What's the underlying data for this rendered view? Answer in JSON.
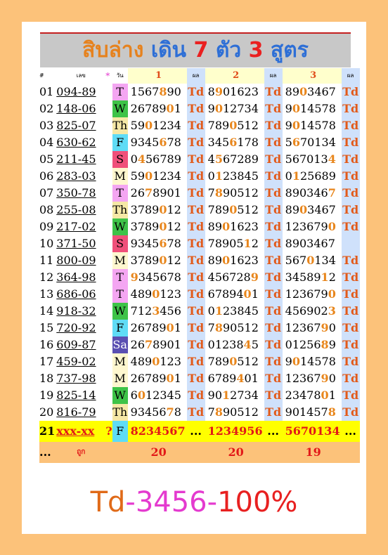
{
  "title": {
    "part1": "สิบล่าง",
    "part2": " เดิน ",
    "part3": "7",
    "part4": " ตัว ",
    "part5": "3",
    "part6": " สูตร"
  },
  "header": {
    "no": "#",
    "code": "เลข",
    "star": "*",
    "day": "วัน",
    "f1": "1",
    "f2": "2",
    "f3": "3",
    "pl": "ผล"
  },
  "rows": [
    {
      "no": "01",
      "code": "094-89",
      "day": "T",
      "dayClass": "T",
      "f": [
        [
          "1567",
          "8",
          "90"
        ],
        [
          "8",
          "9",
          "01623"
        ],
        [
          "89",
          "0",
          "3467"
        ]
      ],
      "r": [
        "Td",
        "Td",
        "Td"
      ]
    },
    {
      "no": "02",
      "code": "148-06",
      "day": "W",
      "dayClass": "W",
      "f": [
        [
          "26789",
          "0",
          "1"
        ],
        [
          "9",
          "0",
          "12734"
        ],
        [
          "9",
          "0",
          "14578"
        ]
      ],
      "r": [
        "Td",
        "Td",
        "Td"
      ]
    },
    {
      "no": "03",
      "code": "825-07",
      "day": "Th",
      "dayClass": "Th",
      "f": [
        [
          "59",
          "0",
          "1234"
        ],
        [
          "789",
          "0",
          "512"
        ],
        [
          "9",
          "0",
          "14578"
        ]
      ],
      "r": [
        "Td",
        "Td",
        "Td"
      ]
    },
    {
      "no": "04",
      "code": "630-62",
      "day": "F",
      "dayClass": "F",
      "f": [
        [
          "9345",
          "6",
          "78"
        ],
        [
          "345",
          "6",
          "178"
        ],
        [
          "5",
          "6",
          "70134"
        ]
      ],
      "r": [
        "Td",
        "Td",
        "Td"
      ]
    },
    {
      "no": "05",
      "code": "211-45",
      "day": "S",
      "dayClass": "S",
      "f": [
        [
          "0",
          "4",
          "56789"
        ],
        [
          "4",
          "5",
          "67289"
        ],
        [
          "567013",
          "4",
          ""
        ]
      ],
      "r": [
        "Td",
        "Td",
        "Td"
      ]
    },
    {
      "no": "06",
      "code": "283-03",
      "day": "M",
      "dayClass": "M",
      "f": [
        [
          "59",
          "0",
          "1234"
        ],
        [
          "0",
          "1",
          "23845"
        ],
        [
          "0",
          "1",
          "25689"
        ]
      ],
      "r": [
        "Td",
        "Td",
        "Td"
      ]
    },
    {
      "no": "07",
      "code": "350-78",
      "day": "T",
      "dayClass": "T",
      "f": [
        [
          "26",
          "7",
          "8901"
        ],
        [
          "7",
          "8",
          "90512"
        ],
        [
          "890346",
          "7",
          ""
        ]
      ],
      "r": [
        "Td",
        "Td",
        "Td"
      ]
    },
    {
      "no": "08",
      "code": "255-08",
      "day": "Th",
      "dayClass": "Th",
      "f": [
        [
          "3789",
          "0",
          "12"
        ],
        [
          "789",
          "0",
          "512"
        ],
        [
          "89",
          "0",
          "3467"
        ]
      ],
      "r": [
        "Td",
        "Td",
        "Td"
      ]
    },
    {
      "no": "09",
      "code": "217-02",
      "day": "W",
      "dayClass": "W",
      "f": [
        [
          "3789",
          "0",
          "12"
        ],
        [
          "89",
          "0",
          "1623"
        ],
        [
          "123679",
          "0",
          ""
        ]
      ],
      "r": [
        "Td",
        "Td",
        "Td"
      ]
    },
    {
      "no": "10",
      "code": "371-50",
      "day": "S",
      "dayClass": "S",
      "f": [
        [
          "9345",
          "6",
          "78"
        ],
        [
          "78905",
          "1",
          "2"
        ],
        [
          "8903467",
          "",
          ""
        ]
      ],
      "r": [
        "Td",
        "Td",
        ""
      ]
    },
    {
      "no": "11",
      "code": "800-09",
      "day": "M",
      "dayClass": "M",
      "f": [
        [
          "3789",
          "0",
          "12"
        ],
        [
          "89",
          "0",
          "1623"
        ],
        [
          "567",
          "0",
          "134"
        ]
      ],
      "r": [
        "Td",
        "Td",
        "Td"
      ]
    },
    {
      "no": "12",
      "code": "364-98",
      "day": "T",
      "dayClass": "T",
      "f": [
        [
          "",
          "9",
          "345678"
        ],
        [
          "456728",
          "9",
          ""
        ],
        [
          "34589",
          "1",
          "2"
        ]
      ],
      "r": [
        "Td",
        "Td",
        "Td"
      ]
    },
    {
      "no": "13",
      "code": "686-06",
      "day": "T",
      "dayClass": "T",
      "f": [
        [
          "489",
          "0",
          "123"
        ],
        [
          "67894",
          "0",
          "1"
        ],
        [
          "123679",
          "0",
          ""
        ]
      ],
      "r": [
        "Td",
        "Td",
        "Td"
      ]
    },
    {
      "no": "14",
      "code": "918-32",
      "day": "W",
      "dayClass": "W",
      "f": [
        [
          "712",
          "3",
          "456"
        ],
        [
          "0",
          "1",
          "23845"
        ],
        [
          "456902",
          "3",
          ""
        ]
      ],
      "r": [
        "Td",
        "Td",
        "Td"
      ]
    },
    {
      "no": "15",
      "code": "720-92",
      "day": "F",
      "dayClass": "F",
      "f": [
        [
          "26789",
          "0",
          "1"
        ],
        [
          "7",
          "8",
          "90512"
        ],
        [
          "12367",
          "9",
          "0"
        ]
      ],
      "r": [
        "Td",
        "Td",
        "Td"
      ]
    },
    {
      "no": "16",
      "code": "609-87",
      "day": "Sa",
      "dayClass": "Sa",
      "f": [
        [
          "26",
          "7",
          "8901"
        ],
        [
          "01238",
          "4",
          "5"
        ],
        [
          "01256",
          "8",
          "9"
        ]
      ],
      "r": [
        "Td",
        "Td",
        "Td"
      ]
    },
    {
      "no": "17",
      "code": "459-02",
      "day": "M",
      "dayClass": "M",
      "f": [
        [
          "489",
          "0",
          "123"
        ],
        [
          "789",
          "0",
          "512"
        ],
        [
          "9",
          "0",
          "14578"
        ]
      ],
      "r": [
        "Td",
        "Td",
        "Td"
      ]
    },
    {
      "no": "18",
      "code": "737-98",
      "day": "M",
      "dayClass": "M",
      "f": [
        [
          "26789",
          "0",
          "1"
        ],
        [
          "6789",
          "4",
          "01"
        ],
        [
          "12367",
          "9",
          "0"
        ]
      ],
      "r": [
        "Td",
        "Td",
        "Td"
      ]
    },
    {
      "no": "19",
      "code": "825-14",
      "day": "W",
      "dayClass": "W",
      "f": [
        [
          "6",
          "0",
          "12345"
        ],
        [
          "90",
          "1",
          "2734"
        ],
        [
          "23478",
          "0",
          "1"
        ]
      ],
      "r": [
        "Td",
        "Td",
        "Td"
      ]
    },
    {
      "no": "20",
      "code": "816-79",
      "day": "Th",
      "dayClass": "Th",
      "f": [
        [
          "93456",
          "7",
          "8"
        ],
        [
          "7",
          "8",
          "90512"
        ],
        [
          "901457",
          "8",
          ""
        ]
      ],
      "r": [
        "Td",
        "Td",
        "Td"
      ]
    }
  ],
  "last": {
    "no": "21",
    "code": "xxx-xx",
    "star": "?",
    "day": "F",
    "f1": "8234567",
    "f2": "1234956",
    "f3": "5670134",
    "r": "..."
  },
  "summary": {
    "dots": "...",
    "label": "ถูก",
    "h1": "20",
    "h2": "20",
    "h3": "19"
  },
  "footer": {
    "p1": "Td",
    "p2": "-3456-",
    "p3": "100%"
  }
}
